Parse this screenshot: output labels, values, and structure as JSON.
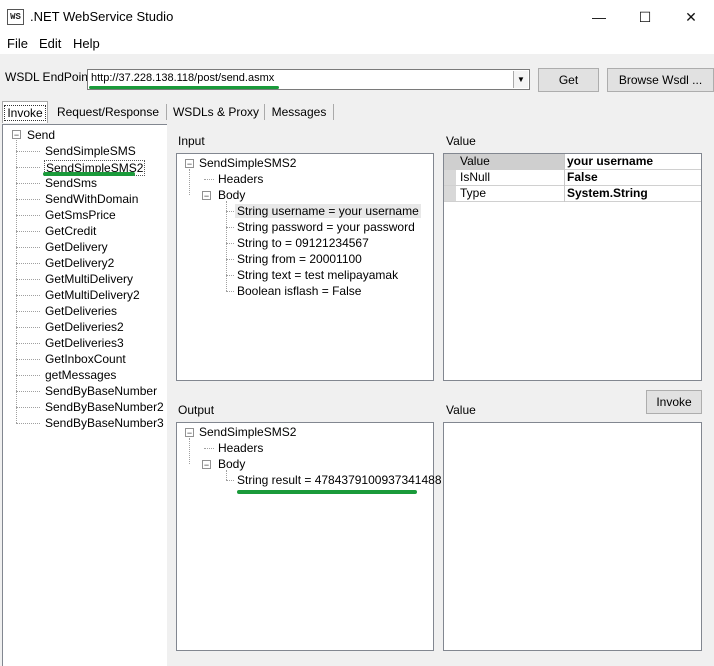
{
  "window": {
    "title": ".NET WebService Studio",
    "icon_text": "WS",
    "minimize_glyph": "—",
    "maximize_glyph": "☐",
    "close_glyph": "✕"
  },
  "menu": {
    "items": [
      "File",
      "Edit",
      "Help"
    ]
  },
  "endpoint": {
    "label": "WSDL EndPoint",
    "value": "http://37.228.138.118/post/send.asmx",
    "get_button": "Get",
    "browse_button": "Browse Wsdl ..."
  },
  "tabs": [
    "Invoke",
    "Request/Response",
    "WSDLs & Proxy",
    "Messages"
  ],
  "methods_tree": {
    "root": "Send",
    "selected": "SendSimpleSMS2",
    "items": [
      "SendSimpleSMS",
      "SendSimpleSMS2",
      "SendSms",
      "SendWithDomain",
      "GetSmsPrice",
      "GetCredit",
      "GetDelivery",
      "GetDelivery2",
      "GetMultiDelivery",
      "GetMultiDelivery2",
      "GetDeliveries",
      "GetDeliveries2",
      "GetDeliveries3",
      "GetInboxCount",
      "getMessages",
      "SendByBaseNumber",
      "SendByBaseNumber2",
      "SendByBaseNumber3"
    ]
  },
  "input": {
    "label": "Input",
    "root": "SendSimpleSMS2",
    "headers": "Headers",
    "body": "Body",
    "params": [
      "String username = your username",
      "String password = your password",
      "String to = 09121234567",
      "String from = 20001100",
      "String text = test melipayamak",
      "Boolean isflash = False"
    ]
  },
  "input_value": {
    "label": "Value",
    "rows": [
      {
        "name": "Value",
        "value": "your username"
      },
      {
        "name": "IsNull",
        "value": "False"
      },
      {
        "name": "Type",
        "value": "System.String"
      }
    ]
  },
  "invoke_button": "Invoke",
  "output": {
    "label": "Output",
    "root": "SendSimpleSMS2",
    "headers": "Headers",
    "body": "Body",
    "result": "String result = 4784379100937341488"
  },
  "output_value": {
    "label": "Value"
  },
  "colors": {
    "highlight_underline": "#1a9a3a",
    "panel_border": "#828790"
  }
}
